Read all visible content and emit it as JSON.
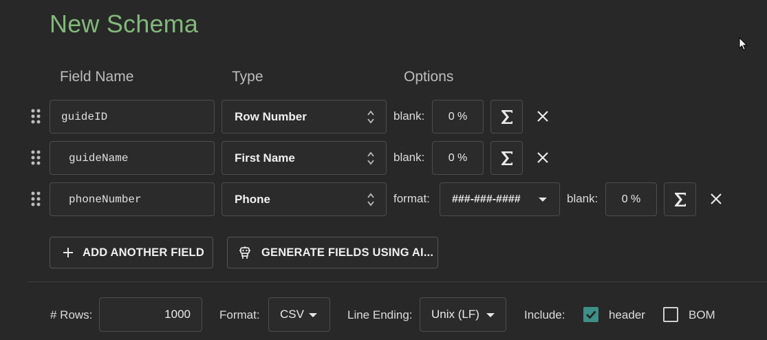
{
  "title": "New Schema",
  "columns": {
    "field_name": "Field Name",
    "type": "Type",
    "options": "Options"
  },
  "fields": [
    {
      "name": "guideID",
      "type": "Row Number",
      "blank_label": "blank:",
      "blank_value": "0 %"
    },
    {
      "name": "guideName",
      "type": "First Name",
      "blank_label": "blank:",
      "blank_value": "0 %"
    },
    {
      "name": "phoneNumber",
      "type": "Phone",
      "format_label": "format:",
      "format_value": "###-###-####",
      "blank_label": "blank:",
      "blank_value": "0 %"
    }
  ],
  "actions": {
    "add_field": "ADD ANOTHER FIELD",
    "generate_ai": "GENERATE FIELDS USING AI..."
  },
  "footer": {
    "rows_label": "# Rows:",
    "rows_value": "1000",
    "format_label": "Format:",
    "format_value": "CSV",
    "line_ending_label": "Line Ending:",
    "line_ending_value": "Unix (LF)",
    "include_label": "Include:",
    "header_label": "header",
    "header_checked": true,
    "bom_label": "BOM",
    "bom_checked": false
  },
  "colors": {
    "title": "#82b87a",
    "checkbox": "#3d8f87",
    "background": "#282828"
  },
  "icons": [
    "drag-handle-icon",
    "sort-arrows-icon",
    "sigma-icon",
    "close-icon",
    "plus-icon",
    "robot-icon",
    "dropdown-caret-icon",
    "checkbox-icon",
    "mouse-cursor-icon"
  ]
}
